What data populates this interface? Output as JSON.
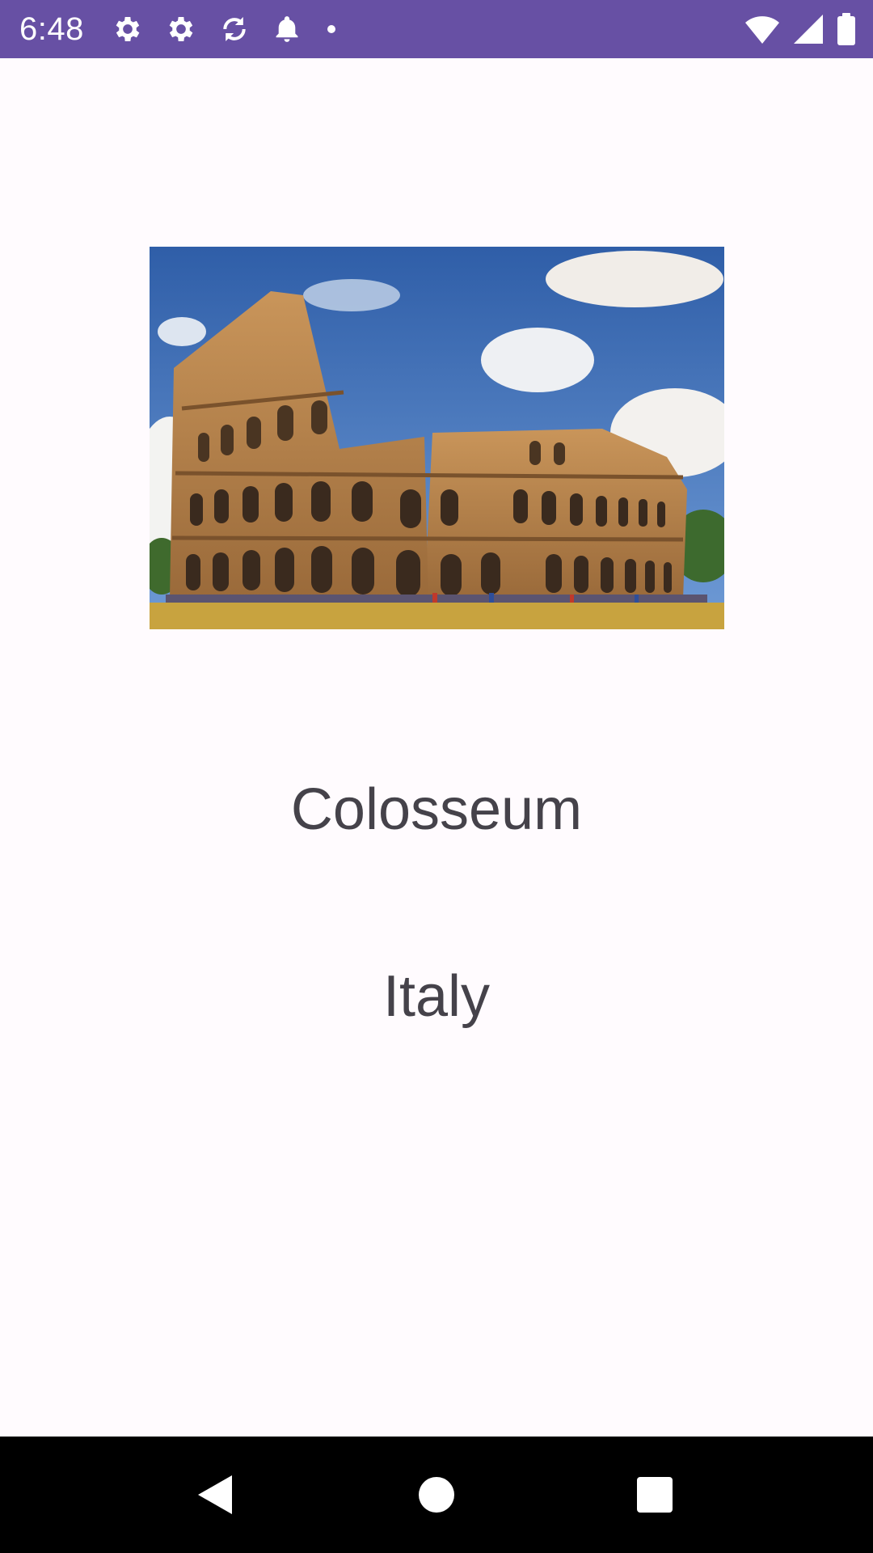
{
  "status_bar": {
    "time": "6:48",
    "left_icons": [
      "settings-icon",
      "settings-icon",
      "sync-icon",
      "notification-bell-icon",
      "dot-icon"
    ],
    "right_icons": [
      "wifi-icon",
      "cell-signal-icon",
      "battery-icon"
    ]
  },
  "landmark": {
    "image_icon": "colosseum-photo",
    "name": "Colosseum",
    "country": "Italy"
  },
  "nav_bar": {
    "buttons": [
      "back-icon",
      "home-icon",
      "recents-icon"
    ]
  },
  "colors": {
    "status_bar": "#6750a4",
    "background": "#fffbfe",
    "text": "#45424a",
    "nav_bar": "#000000"
  }
}
